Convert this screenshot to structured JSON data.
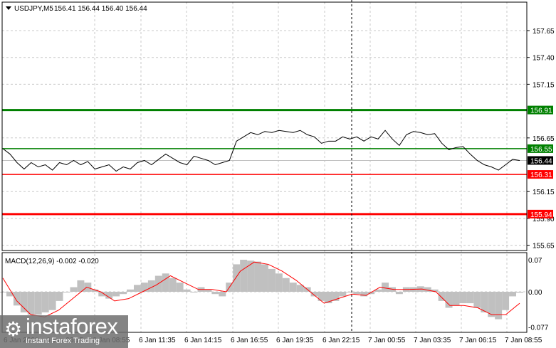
{
  "header": {
    "symbol": "USDJPY,M5",
    "ohlc": "156.41 156.44 156.40 156.44"
  },
  "macd_label": "MACD(12,26,9) -0.002 -0.020",
  "colors": {
    "green": "#008000",
    "red": "#ff0000",
    "price": "#000000",
    "hist": "#c0c0c0",
    "signal": "#ff0000"
  },
  "logo": {
    "brand": "instaforex",
    "tagline": "Instant Forex Trading"
  },
  "chart_data": {
    "type": "line",
    "title": "USDJPY,M5",
    "price_ticks": [
      "157.65",
      "157.40",
      "157.15",
      "156.65",
      "156.15",
      "155.90",
      "155.65"
    ],
    "price_tick_values": [
      157.65,
      157.4,
      157.15,
      156.65,
      156.15,
      155.9,
      155.65
    ],
    "levels": [
      {
        "label": "156.91",
        "value": 156.91,
        "color": "green"
      },
      {
        "label": "156.55",
        "value": 156.55,
        "color": "green"
      },
      {
        "label": "156.31",
        "value": 156.31,
        "color": "red"
      },
      {
        "label": "155.94",
        "value": 155.94,
        "color": "red"
      }
    ],
    "current_price": {
      "label": "156.44",
      "value": 156.44
    },
    "time_labels": [
      "6 Jan 2026",
      "6 Jan 06:15",
      "6 Jan 08:55",
      "6 Jan 11:35",
      "6 Jan 14:15",
      "6 Jan 16:55",
      "6 Jan 19:35",
      "6 Jan 22:15",
      "7 Jan 00:55",
      "7 Jan 03:35",
      "7 Jan 06:15",
      "7 Jan 08:55"
    ],
    "price": [
      156.55,
      156.5,
      156.42,
      156.36,
      156.42,
      156.38,
      156.4,
      156.35,
      156.42,
      156.4,
      156.44,
      156.4,
      156.43,
      156.36,
      156.38,
      156.4,
      156.34,
      156.38,
      156.36,
      156.42,
      156.44,
      156.4,
      156.45,
      156.5,
      156.46,
      156.42,
      156.4,
      156.48,
      156.46,
      156.44,
      156.4,
      156.42,
      156.44,
      156.62,
      156.66,
      156.7,
      156.68,
      156.71,
      156.7,
      156.72,
      156.71,
      156.7,
      156.72,
      156.68,
      156.66,
      156.6,
      156.62,
      156.62,
      156.66,
      156.64,
      156.66,
      156.62,
      156.66,
      156.64,
      156.72,
      156.64,
      156.58,
      156.68,
      156.71,
      156.7,
      156.68,
      156.69,
      156.6,
      156.54,
      156.56,
      156.57,
      156.5,
      156.44,
      156.4,
      156.38,
      156.35,
      156.4,
      156.45,
      156.44
    ],
    "macd_ticks": [
      "0.07",
      "0.00",
      "-0.077"
    ],
    "macd_tick_values": [
      0.07,
      0.0,
      -0.077
    ],
    "macd_hist": [
      0,
      -0.01,
      -0.03,
      -0.045,
      -0.05,
      -0.05,
      -0.045,
      -0.04,
      -0.02,
      0,
      0.01,
      0.025,
      0.02,
      0.005,
      -0.01,
      -0.015,
      -0.01,
      -0.005,
      0.005,
      0.015,
      0.02,
      0.025,
      0.035,
      0.04,
      0.03,
      0.02,
      0.005,
      0,
      0.01,
      0.005,
      -0.005,
      -0.01,
      0.02,
      0.06,
      0.07,
      0.068,
      0.066,
      0.06,
      0.05,
      0.04,
      0.03,
      0.02,
      0.015,
      0.01,
      -0.01,
      -0.02,
      -0.025,
      -0.02,
      -0.01,
      0,
      -0.005,
      -0.01,
      -0.005,
      0.005,
      0.02,
      0.01,
      -0.005,
      0.01,
      0.01,
      0.012,
      0.01,
      0.005,
      -0.02,
      -0.035,
      -0.03,
      -0.025,
      -0.025,
      -0.035,
      -0.045,
      -0.055,
      -0.06,
      -0.04,
      -0.01,
      -0.002
    ],
    "macd_signal": [
      0.03,
      -0.02,
      -0.05,
      -0.055,
      -0.04,
      -0.015,
      0.01,
      0,
      -0.02,
      -0.015,
      0,
      0.015,
      0.035,
      0.02,
      0.005,
      0.005,
      0,
      0.045,
      0.065,
      0.06,
      0.045,
      0.025,
      0,
      -0.025,
      -0.015,
      -0.005,
      -0.008,
      0.01,
      0.005,
      0.005,
      0.006,
      0,
      -0.03,
      -0.03,
      -0.035,
      -0.05,
      -0.05,
      -0.025
    ]
  }
}
